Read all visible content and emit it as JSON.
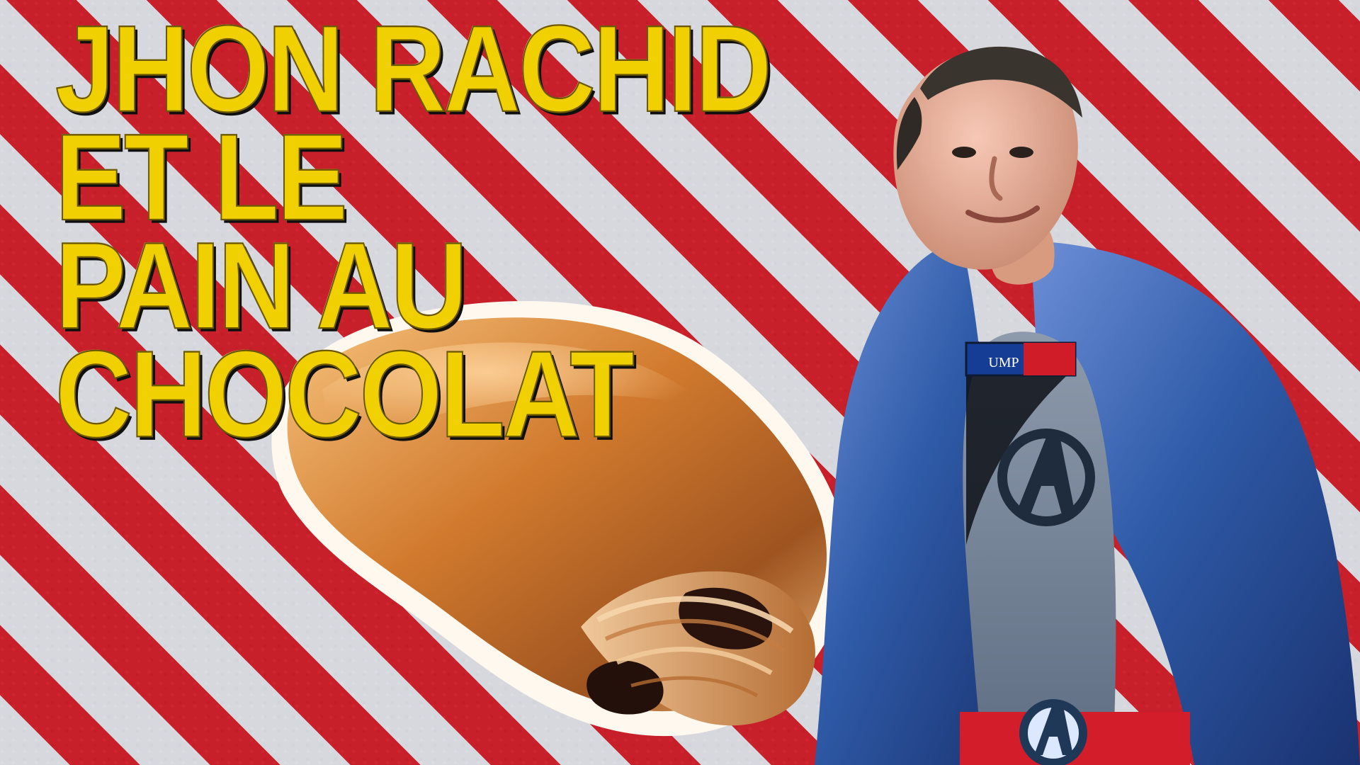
{
  "headline": {
    "line1": "JHON RACHID ET LE",
    "line2": "PAIN AU CHOCOLAT"
  },
  "badge_text": "UMP",
  "colors": {
    "stripe_red": "#c8202a",
    "stripe_light": "#d7d7de",
    "title_yellow": "#f0d000",
    "cape_blue": "#2f5ba8"
  },
  "objects": {
    "pastry": "pain-au-chocolat",
    "character": "caped-man-with-ump-badge"
  }
}
